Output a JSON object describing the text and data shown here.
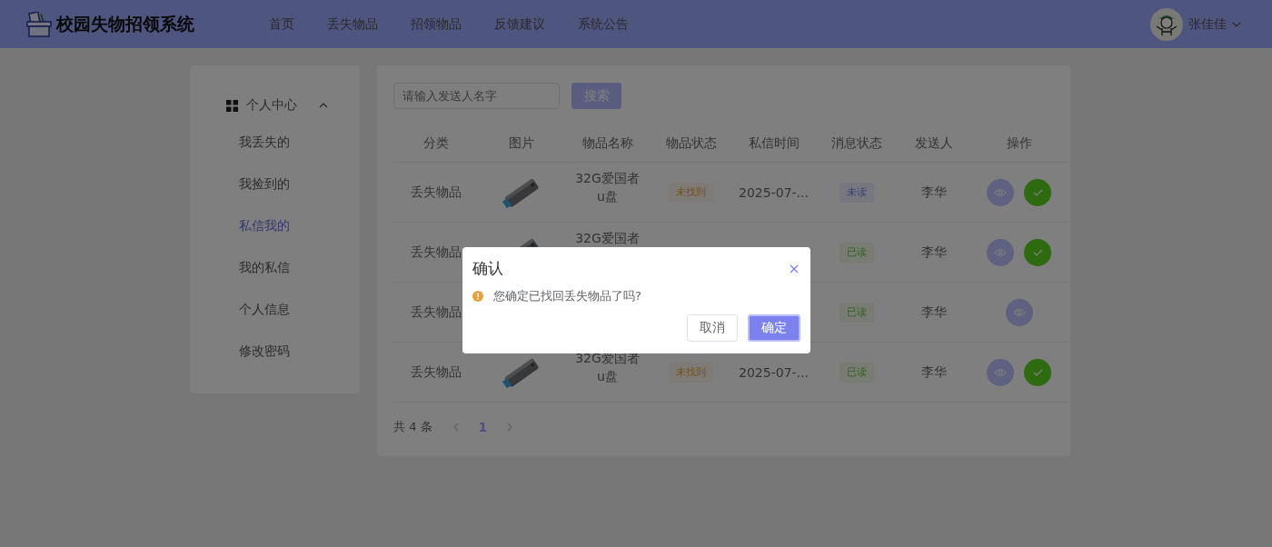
{
  "header": {
    "title": "校园失物招领系统",
    "nav": [
      {
        "label": "首页",
        "selected": false
      },
      {
        "label": "丢失物品",
        "selected": false
      },
      {
        "label": "招领物品",
        "selected": false
      },
      {
        "label": "反馈建议",
        "selected": false
      },
      {
        "label": "系统公告",
        "selected": false
      }
    ],
    "user": {
      "name": "张佳佳"
    }
  },
  "sidebar": {
    "group": {
      "label": "个人中心",
      "expanded": true
    },
    "items": [
      {
        "label": "我丢失的",
        "selected": false
      },
      {
        "label": "我捡到的",
        "selected": false
      },
      {
        "label": "私信我的",
        "selected": true
      },
      {
        "label": "我的私信",
        "selected": false
      },
      {
        "label": "个人信息",
        "selected": false
      },
      {
        "label": "修改密码",
        "selected": false
      }
    ]
  },
  "search": {
    "placeholder": "请输入发送人名字",
    "button": "搜索"
  },
  "table": {
    "columns": [
      "分类",
      "图片",
      "物品名称",
      "物品状态",
      "私信时间",
      "消息状态",
      "发送人",
      "操作"
    ],
    "rows": [
      {
        "category": "丢失物品",
        "name": "32G爱国者u盘",
        "item_status": {
          "text": "未找到",
          "kind": "warning"
        },
        "time": "2025-07-...",
        "msg_status": {
          "text": "未读",
          "kind": "info"
        },
        "sender": "李华",
        "can_confirm": true
      },
      {
        "category": "丢失物品",
        "name": "32G爱国者",
        "msg_status": {
          "text": "已读",
          "kind": "success"
        },
        "sender": "李华",
        "can_confirm": true
      },
      {
        "category": "丢失物品",
        "msg_status": {
          "text": "已读",
          "kind": "success"
        },
        "sender": "李华",
        "can_confirm": false
      },
      {
        "category": "丢失物品",
        "name": "32G爱国者u盘",
        "item_status": {
          "text": "未找到",
          "kind": "warning"
        },
        "time": "2025-07-...",
        "msg_status": {
          "text": "已读",
          "kind": "success"
        },
        "sender": "李华",
        "can_confirm": true
      }
    ]
  },
  "pagination": {
    "total": "共 4 条",
    "pages": [
      {
        "label": "1",
        "selected": true
      }
    ]
  },
  "dialog": {
    "title": "确认",
    "message": "您确定已找回丢失物品了吗?",
    "cancel": "取消",
    "confirm": "确定"
  }
}
